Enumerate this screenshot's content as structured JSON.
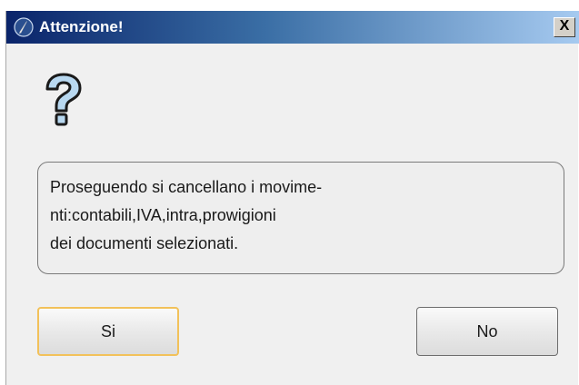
{
  "window": {
    "title": "Attenzione!",
    "close_label": "X",
    "title_icon": "pen-icon"
  },
  "body": {
    "icon": "question-icon",
    "message_lines": [
      "Proseguendo si cancellano i movime-",
      "nti:contabili,IVA,intra,prowigioni",
      "dei documenti selezionati."
    ]
  },
  "buttons": {
    "yes_label": "Si",
    "no_label": "No"
  },
  "colors": {
    "titlebar_start": "#0a246a",
    "titlebar_end": "#a6caf0",
    "focus_border": "#f2c15a",
    "question_fill": "#b8d8f0"
  }
}
